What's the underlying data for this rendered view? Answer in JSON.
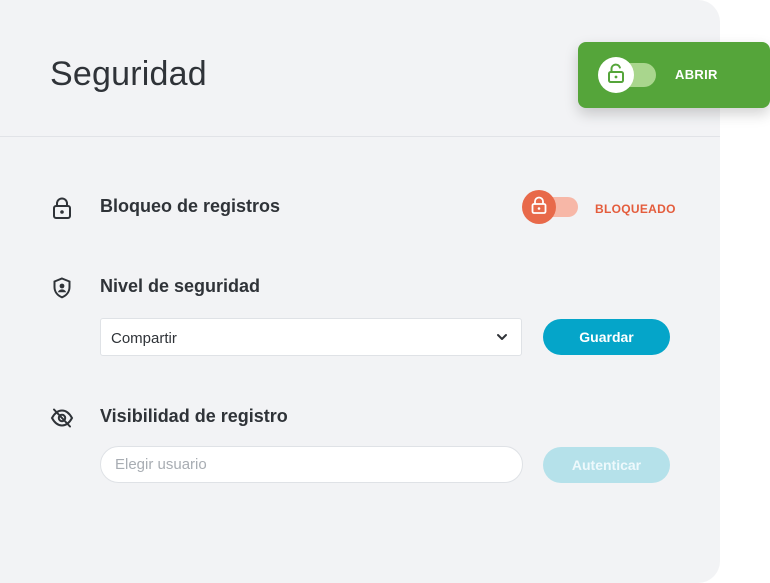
{
  "header": {
    "title": "Seguridad"
  },
  "open_toggle": {
    "label": "ABRIR",
    "state": "on",
    "color": "#55a53a"
  },
  "lock_setting": {
    "label": "Bloqueo de registros",
    "status": "BLOQUEADO",
    "state": "on",
    "color": "#e8694a",
    "icon": "lock-icon"
  },
  "security_level": {
    "label": "Nivel de seguridad",
    "icon": "shield-user-icon",
    "selected": "Compartir",
    "save_label": "Guardar",
    "button_color": "#05a5c9"
  },
  "visibility": {
    "label": "Visibilidad de registro",
    "icon": "eye-off-icon",
    "placeholder": "Elegir usuario",
    "auth_label": "Autenticar",
    "button_state": "disabled"
  }
}
